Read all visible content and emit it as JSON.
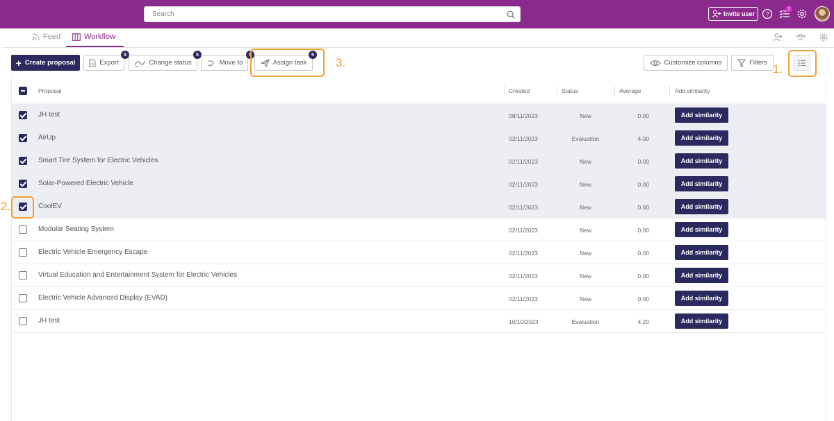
{
  "colors": {
    "brand": "#8b2a8d",
    "primary": "#2b2a5e",
    "highlight": "#f0a030",
    "selected_row": "#ededf4"
  },
  "header": {
    "search_placeholder": "Search",
    "invite_label": "Invite user",
    "tasks_badge": "1"
  },
  "tabs": [
    {
      "label": "Feed",
      "icon": "rss-icon"
    },
    {
      "label": "Workflow",
      "icon": "board-icon",
      "active": true
    }
  ],
  "toolbar": {
    "create_label": "Create proposal",
    "export_label": "Export",
    "export_count": "5",
    "change_status_label": "Change status",
    "change_status_count": "5",
    "move_to_label": "Move to",
    "move_to_count": "5",
    "assign_task_label": "Assign task",
    "assign_task_count": "5",
    "customize_label": "Customize columns",
    "filters_label": "Filters"
  },
  "annotations": {
    "step1": "1.",
    "step2": "2.",
    "step3": "3."
  },
  "table": {
    "headers": {
      "proposal": "Proposal",
      "created": "Created",
      "status": "Status",
      "average": "Average",
      "add_similarity": "Add similarity"
    },
    "rows": [
      {
        "proposal": "JH test",
        "created": "08/11/2023",
        "status": "New",
        "average": "0.00",
        "action": "Add similarity",
        "checked": true
      },
      {
        "proposal": "AirUp",
        "created": "02/11/2023",
        "status": "Evaluation",
        "average": "4.00",
        "action": "Add similarity",
        "checked": true
      },
      {
        "proposal": "Smart Tire System for Electric Vehicles",
        "created": "02/11/2023",
        "status": "New",
        "average": "0.00",
        "action": "Add similarity",
        "checked": true
      },
      {
        "proposal": "Solar-Powered Electric Vehicle",
        "created": "02/11/2023",
        "status": "New",
        "average": "0.00",
        "action": "Add similarity",
        "checked": true
      },
      {
        "proposal": "CoolEV",
        "created": "02/11/2023",
        "status": "New",
        "average": "0.00",
        "action": "Add similarity",
        "checked": true
      },
      {
        "proposal": "Modular Seating System",
        "created": "02/11/2023",
        "status": "New",
        "average": "0.00",
        "action": "Add similarity",
        "checked": false
      },
      {
        "proposal": "Electric Vehicle Emergency Escape",
        "created": "02/11/2023",
        "status": "New",
        "average": "0.00",
        "action": "Add similarity",
        "checked": false
      },
      {
        "proposal": "Virtual Education and Entertainment System for Electric Vehicles",
        "created": "02/11/2023",
        "status": "New",
        "average": "0.00",
        "action": "Add similarity",
        "checked": false
      },
      {
        "proposal": "Electric Vehicle Advanced Display (EVAD)",
        "created": "02/11/2023",
        "status": "New",
        "average": "0.00",
        "action": "Add similarity",
        "checked": false
      },
      {
        "proposal": "JH test",
        "created": "10/10/2023",
        "status": "Evaluation",
        "average": "4.20",
        "action": "Add similarity",
        "checked": false
      }
    ]
  }
}
